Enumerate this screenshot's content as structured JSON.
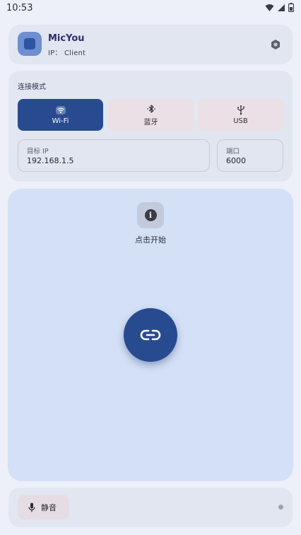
{
  "status_bar": {
    "time": "10:53"
  },
  "header": {
    "app_name": "MicYou",
    "ip_label": "IP： Client"
  },
  "mode": {
    "title": "连接模式",
    "options": [
      {
        "label": "Wi-Fi",
        "icon": "wifi-icon",
        "active": true
      },
      {
        "label": "蓝牙",
        "icon": "bluetooth-icon",
        "active": false
      },
      {
        "label": "USB",
        "icon": "usb-icon",
        "active": false
      }
    ],
    "target_ip": {
      "label": "目标 IP",
      "value": "192.168.1.5"
    },
    "port": {
      "label": "端口",
      "value": "6000"
    }
  },
  "main": {
    "hint": "点击开始",
    "info_icon": "info-icon",
    "connect_icon": "link-icon"
  },
  "bottom": {
    "mute_label": "静音",
    "mute_icon": "mic-icon"
  },
  "colors": {
    "accent": "#284b90",
    "surface": "#e2e6f1",
    "main_surface": "#d3e0f6",
    "background": "#edf0f8"
  }
}
